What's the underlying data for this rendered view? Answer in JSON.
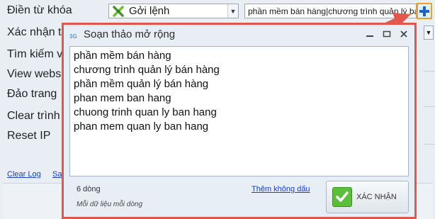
{
  "form": {
    "rows": [
      {
        "label": "Điền từ khóa"
      },
      {
        "label": "Xác nhận t"
      },
      {
        "label": "Tìm kiếm v"
      },
      {
        "label": "View webs"
      },
      {
        "label": "Đảo trang"
      },
      {
        "label": "Clear trình"
      },
      {
        "label": "Reset IP"
      }
    ],
    "command_select": {
      "value": "Gởi lệnh",
      "icon": "tools-icon"
    },
    "keyword_field": {
      "value": "phần mềm bán hàng|chương trình quản lý bán hàng"
    },
    "expand_button": {
      "icon": "plus-icon"
    }
  },
  "bottom_links": {
    "clear_log": "Clear Log",
    "second": "Sa"
  },
  "dialog": {
    "title": "Soạn thảo mở rộng",
    "lines": [
      "phần mềm bán hàng",
      "chương trình quản lý bán hàng",
      "phần mềm quản lý bán hàng",
      "phan mem ban hang",
      "chuong trinh quan ly ban hang",
      "phan mem quan ly ban hang"
    ],
    "line_count": "6 dòng",
    "hint": "Mỗi dữ liệu mỗi dòng",
    "add_no_accent": "Thêm không dấu",
    "confirm_label": "XÁC NHẬN",
    "accent_color": "#e2574c"
  }
}
